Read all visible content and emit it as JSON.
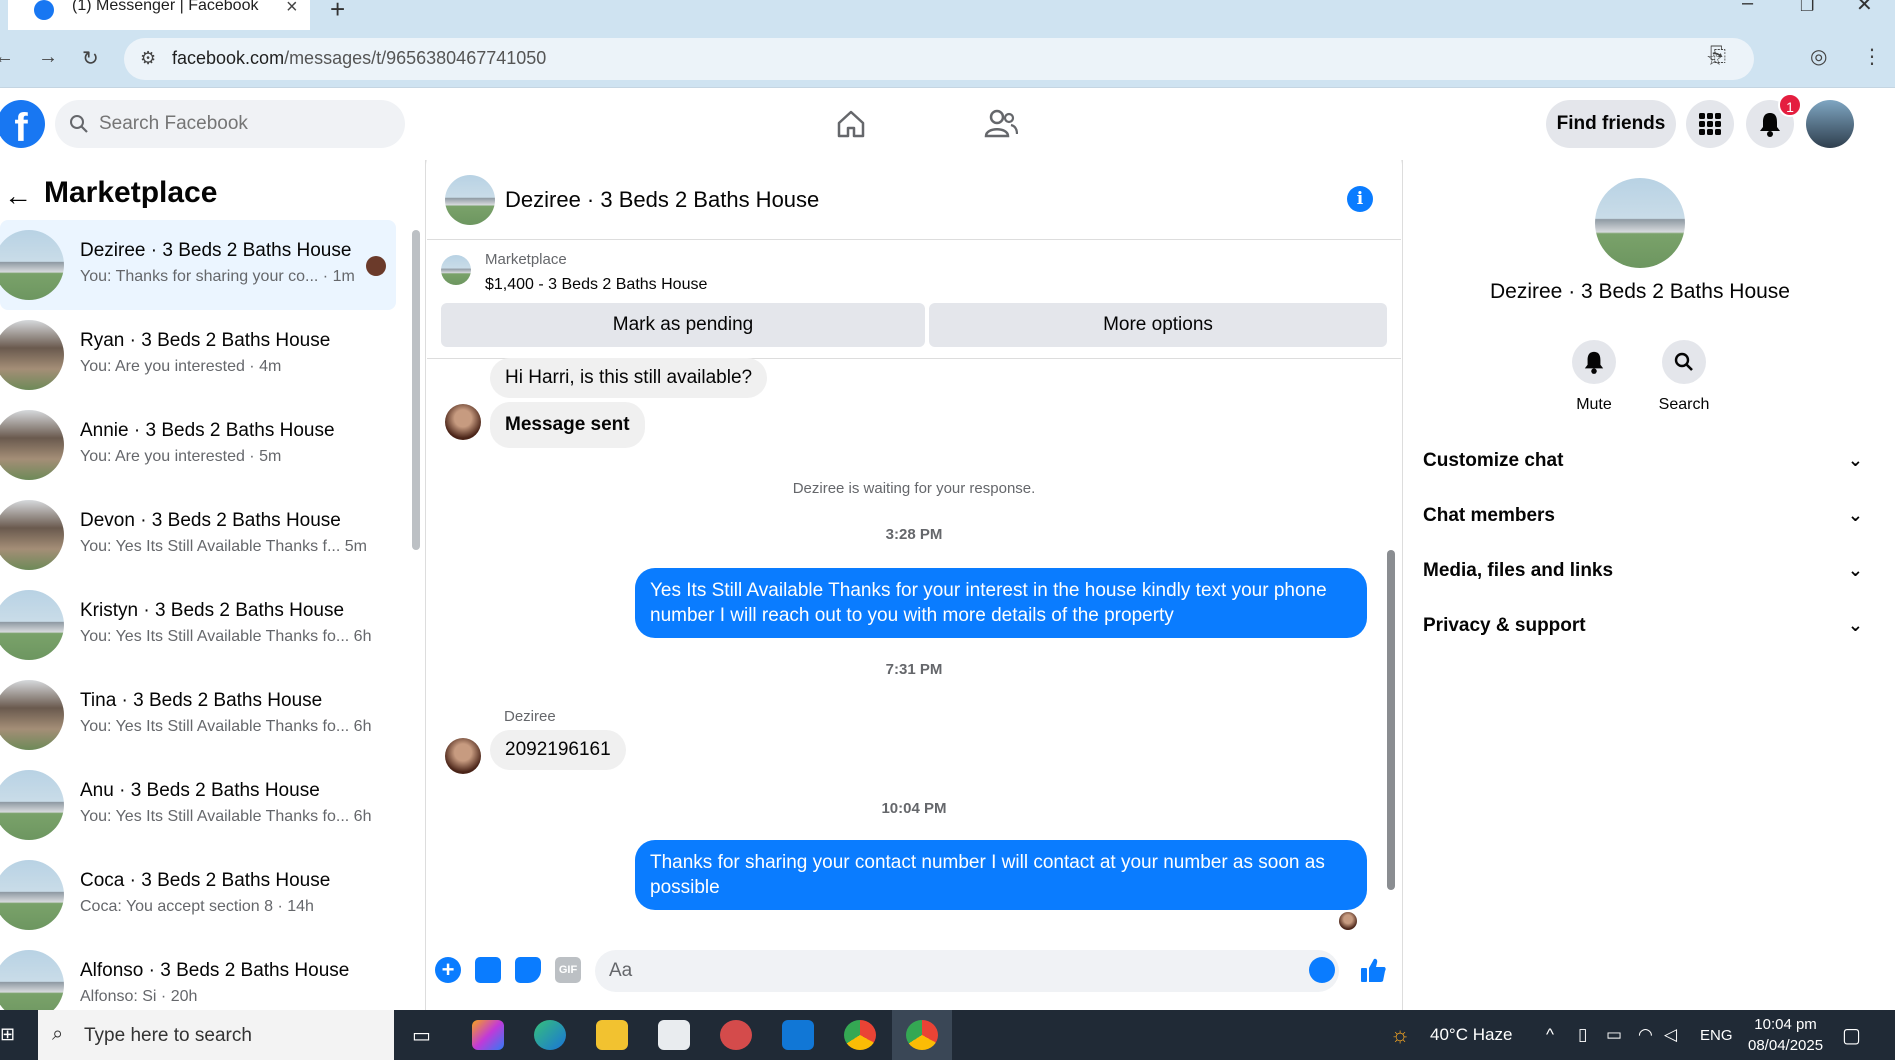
{
  "browser": {
    "tab_title": "(1) Messenger | Facebook",
    "url_host": "facebook.com",
    "url_path": "/messages/t/9656380467741050"
  },
  "header": {
    "search_placeholder": "Search Facebook",
    "find_friends": "Find friends",
    "notification_count": "1"
  },
  "sidebar": {
    "title": "Marketplace",
    "conversations": [
      {
        "name": "Deziree · 3 Beds 2 Baths House",
        "preview": "You: Thanks for sharing your co... · 1m"
      },
      {
        "name": "Ryan · 3 Beds 2 Baths House",
        "preview": "You: Are you interested · 4m"
      },
      {
        "name": "Annie · 3 Beds 2 Baths House",
        "preview": "You: Are you interested · 5m"
      },
      {
        "name": "Devon · 3 Beds 2 Baths House",
        "preview": "You: Yes Its Still Available Thanks f...   5m"
      },
      {
        "name": "Kristyn · 3 Beds 2 Baths House",
        "preview": "You: Yes Its Still Available Thanks fo...   6h"
      },
      {
        "name": "Tina · 3 Beds 2 Baths House",
        "preview": "You: Yes Its Still Available Thanks fo...   6h"
      },
      {
        "name": "Anu · 3 Beds 2 Baths House",
        "preview": "You: Yes Its Still Available Thanks fo...   6h"
      },
      {
        "name": "Coca · 3 Beds 2 Baths House",
        "preview": "Coca: You accept section 8 · 14h"
      },
      {
        "name": "Alfonso · 3 Beds 2 Baths House",
        "preview": "Alfonso: Si · 20h"
      }
    ]
  },
  "chat": {
    "title": "Deziree · 3 Beds 2 Baths House",
    "marketplace_label": "Marketplace",
    "listing": "$1,400 - 3 Beds 2 Baths House",
    "mark_pending": "Mark as pending",
    "more_options": "More options",
    "messages": {
      "in1": "Hi Harri, is this still available?",
      "in2": "Message sent",
      "waiting": "Deziree is waiting for your response.",
      "time1": "3:28 PM",
      "out1": "Yes Its Still Available Thanks for your interest in the house kindly text your phone number I will reach out to you with more details of the property",
      "time2": "7:31 PM",
      "sender": "Deziree",
      "in3": "2092196161",
      "time3": "10:04 PM",
      "out2": "Thanks for sharing your contact number I will contact at your number as soon as possible"
    },
    "composer_placeholder": "Aa"
  },
  "details": {
    "name": "Deziree · 3 Beds 2 Baths House",
    "mute": "Mute",
    "search": "Search",
    "sections": [
      "Customize chat",
      "Chat members",
      "Media, files and links",
      "Privacy & support"
    ]
  },
  "taskbar": {
    "search_placeholder": "Type here to search",
    "weather": "40°C  Haze",
    "language": "ENG",
    "time": "10:04 pm",
    "date": "08/04/2025"
  },
  "colors": {
    "accent": "#0a7cff",
    "brand": "#1877f2",
    "badge": "#e41e3f"
  }
}
